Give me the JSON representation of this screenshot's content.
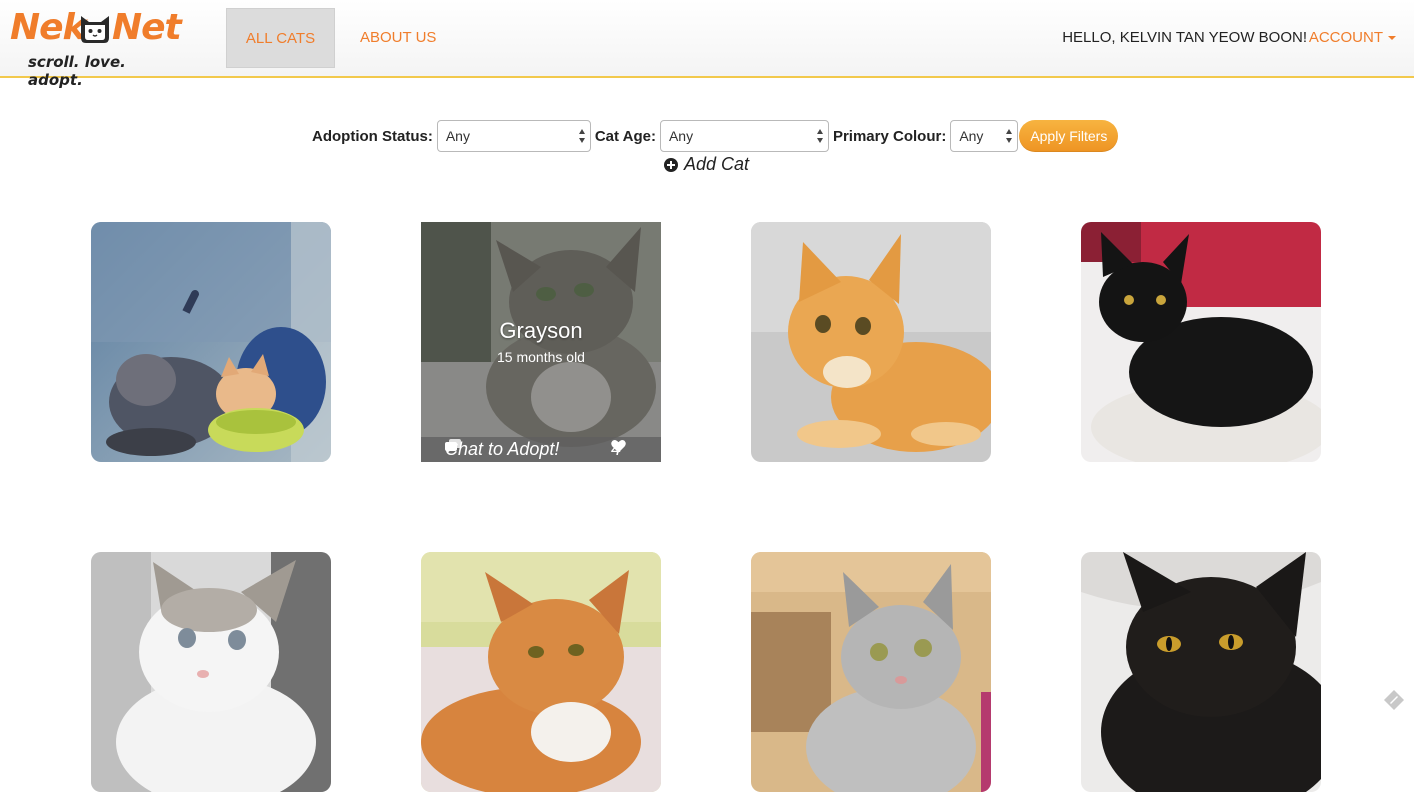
{
  "brand": {
    "logo_left": "Nek",
    "logo_right": "Net",
    "tagline": "scroll. love. adopt."
  },
  "nav": {
    "items": [
      {
        "label": "ALL CATS",
        "active": true
      },
      {
        "label": "ABOUT US",
        "active": false
      }
    ],
    "greeting": "HELLO, KELVIN TAN YEOW BOON!",
    "account_label": "ACCOUNT"
  },
  "filters": {
    "adoption_status": {
      "label": "Adoption Status:",
      "value": "Any"
    },
    "cat_age": {
      "label": "Cat Age:",
      "value": "Any"
    },
    "primary_colour": {
      "label": "Primary Colour:",
      "value": "Any"
    },
    "apply_label": "Apply Filters",
    "add_cat_label": "Add Cat"
  },
  "cats": [
    {
      "photo": "two kittens eating from bowls"
    },
    {
      "photo": "grey tabby cat",
      "hovered": true,
      "name": "Grayson",
      "age": "15 months old",
      "chat_label": "Chat to Adopt!",
      "likes": "4"
    },
    {
      "photo": "orange tabby cat"
    },
    {
      "photo": "black cat on blanket"
    },
    {
      "photo": "white and grey cat"
    },
    {
      "photo": "orange and white cat"
    },
    {
      "photo": "silver tabby cat"
    },
    {
      "photo": "black cat close-up"
    }
  ],
  "colors": {
    "accent": "#f07d2b",
    "button": "#f0a030",
    "nav_border": "#f2c94c"
  }
}
